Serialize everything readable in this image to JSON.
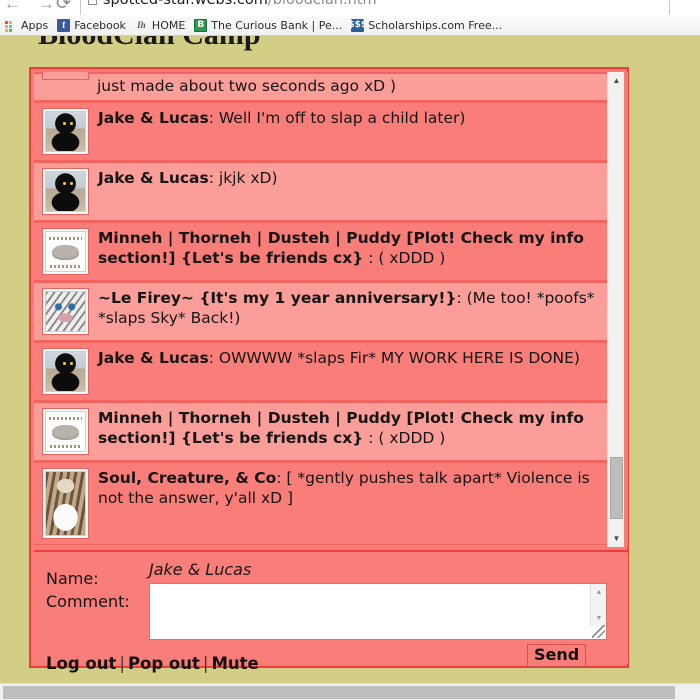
{
  "browser": {
    "url_main": "spotted-star.webs.com",
    "url_path": "/bloodclan.htm",
    "back_forward": "← →",
    "reload_glyph": "⟳",
    "bookmarks": [
      {
        "label": "Apps",
        "icon": "apps-grid-icon"
      },
      {
        "label": "Facebook",
        "icon": "facebook-icon",
        "glyph": "f"
      },
      {
        "label": "HOME",
        "icon": "home-italic-icon",
        "glyph": "Ih"
      },
      {
        "label": "The Curious Bank | Pe...",
        "icon": "curious-bank-icon",
        "glyph": "B"
      },
      {
        "label": "Scholarships.com Free...",
        "icon": "scholarships-icon",
        "glyph": "$$$"
      }
    ]
  },
  "page": {
    "title": "BloodClan Camp",
    "background_color": "#d3ce85",
    "accent_color": "#ef3c3c"
  },
  "chat": {
    "messages": [
      {
        "author": "",
        "text": "just made about two seconds ago xD )",
        "avatar": "partial-avatar",
        "partial": true,
        "row": "even"
      },
      {
        "author": "Jake & Lucas",
        "text": ": Well I'm off to slap a child later)",
        "avatar": "black-cat-avatar",
        "row": "odd"
      },
      {
        "author": "Jake & Lucas",
        "text": ": jkjk xD)",
        "avatar": "black-cat-avatar",
        "row": "even"
      },
      {
        "author": "Minneh | Thorneh | Dusteh | Puddy [Plot! Check my info section!] {Let's be friends cx}",
        "text": " : ( xDDD )",
        "avatar": "pusheen-cat-avatar",
        "row": "odd"
      },
      {
        "author": "~Le Firey~ {It's my 1 year anniversary!}",
        "text": ": (Me too! *poofs* *slaps Sky* Back!)",
        "avatar": "snow-leopard-avatar",
        "row": "even"
      },
      {
        "author": "Jake & Lucas",
        "text": ": OWWWW *slaps Fir* MY WORK HERE IS DONE)",
        "avatar": "black-cat-avatar",
        "row": "odd"
      },
      {
        "author": "Minneh | Thorneh | Dusteh | Puddy [Plot! Check my info section!] {Let's be friends cx}",
        "text": " : ( xDDD )",
        "avatar": "pusheen-cat-avatar",
        "row": "even"
      },
      {
        "author": "Soul, Creature, & Co",
        "text": ": [ *gently pushes talk apart* Violence is not the answer, y'all xD ]",
        "avatar": "calico-cat-avatar",
        "row": "odd",
        "tall_avatar": true
      }
    ],
    "scrollbar": {
      "up_arrow": "▲",
      "down_arrow": "▼"
    }
  },
  "form": {
    "name_label": "Name:",
    "name_value": "Jake & Lucas",
    "comment_label": "Comment:",
    "comment_value": "",
    "comment_placeholder": "",
    "send_label": "Send",
    "links": [
      {
        "label": "Log out"
      },
      {
        "label": "Pop out"
      },
      {
        "label": "Mute"
      }
    ],
    "separator": "|"
  }
}
